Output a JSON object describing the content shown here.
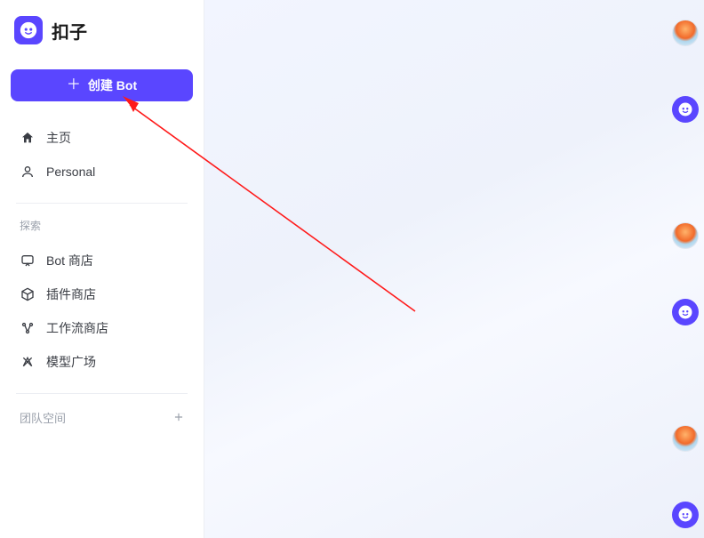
{
  "brand": {
    "title": "扣子"
  },
  "createButton": {
    "label": "创建 Bot"
  },
  "nav": {
    "home": "主页",
    "personal": "Personal"
  },
  "explore": {
    "sectionLabel": "探索",
    "botStore": "Bot 商店",
    "pluginStore": "插件商店",
    "workflowStore": "工作流商店",
    "modelSquare": "模型广场"
  },
  "team": {
    "sectionLabel": "团队空间"
  },
  "rightStrip": {
    "spacings": [
      "0px",
      "56px",
      "112px",
      "56px",
      "112px",
      "56px"
    ]
  }
}
